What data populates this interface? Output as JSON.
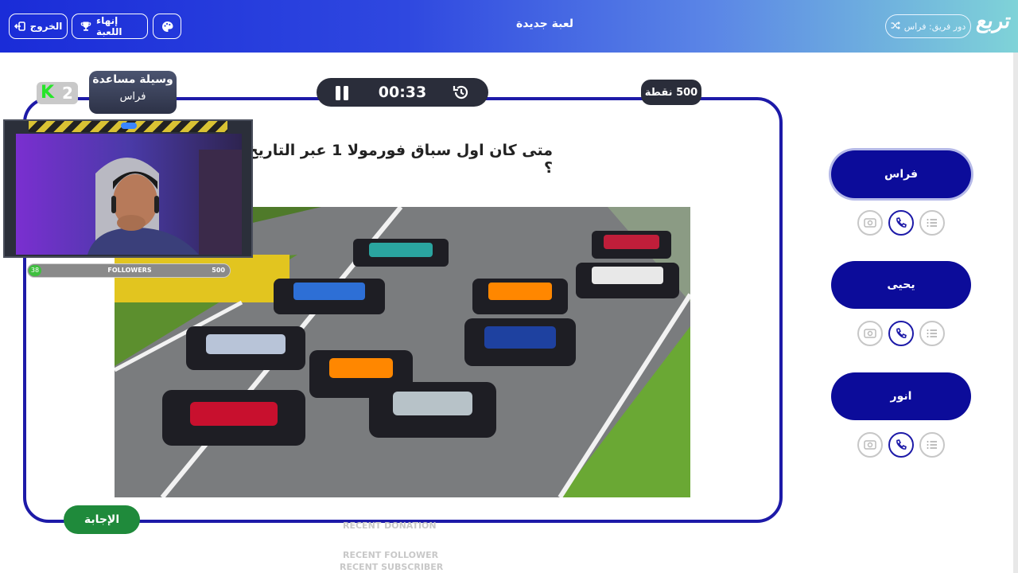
{
  "topbar": {
    "exit_label": "الخروج",
    "end_game_label": "إنهاء اللعبة",
    "game_title": "لعبة جديدة",
    "team_turn_label": "دور فريق: فراس",
    "logo_text": "تربع"
  },
  "question_card": {
    "question": "متى كان اول سباق فورمولا 1 عبر التاريخ ؟",
    "timer": "00:33",
    "points": "500 نقطة",
    "answer_button": "الإجابة"
  },
  "helper": {
    "title": "وسيلة مساعدة",
    "player": "فراس"
  },
  "overlay": {
    "k_count": "2",
    "followers_label": "FOLLOWERS",
    "followers_current": "38",
    "followers_goal": "500",
    "recent_donation": "RECENT DONATION",
    "recent_follower": "RECENT FOLLOWER",
    "recent_subscriber": "RECENT SUBSCRIBER"
  },
  "players": [
    {
      "name": "فراس",
      "active": true
    },
    {
      "name": "يحيى",
      "active": false
    },
    {
      "name": "انور",
      "active": false
    }
  ],
  "colors": {
    "accent": "#1d1aa8",
    "player_button": "#0c0c9a",
    "answer_button": "#1f8a3b",
    "timer_bg": "#2a2d3a"
  },
  "icons": {
    "exit": "logout-icon",
    "end_game": "trophy-icon",
    "palette": "palette-icon",
    "shuffle": "shuffle-icon",
    "pause": "pause-icon",
    "history": "history-icon",
    "tools": [
      "double-points-icon",
      "phone-icon",
      "list-icon"
    ]
  }
}
